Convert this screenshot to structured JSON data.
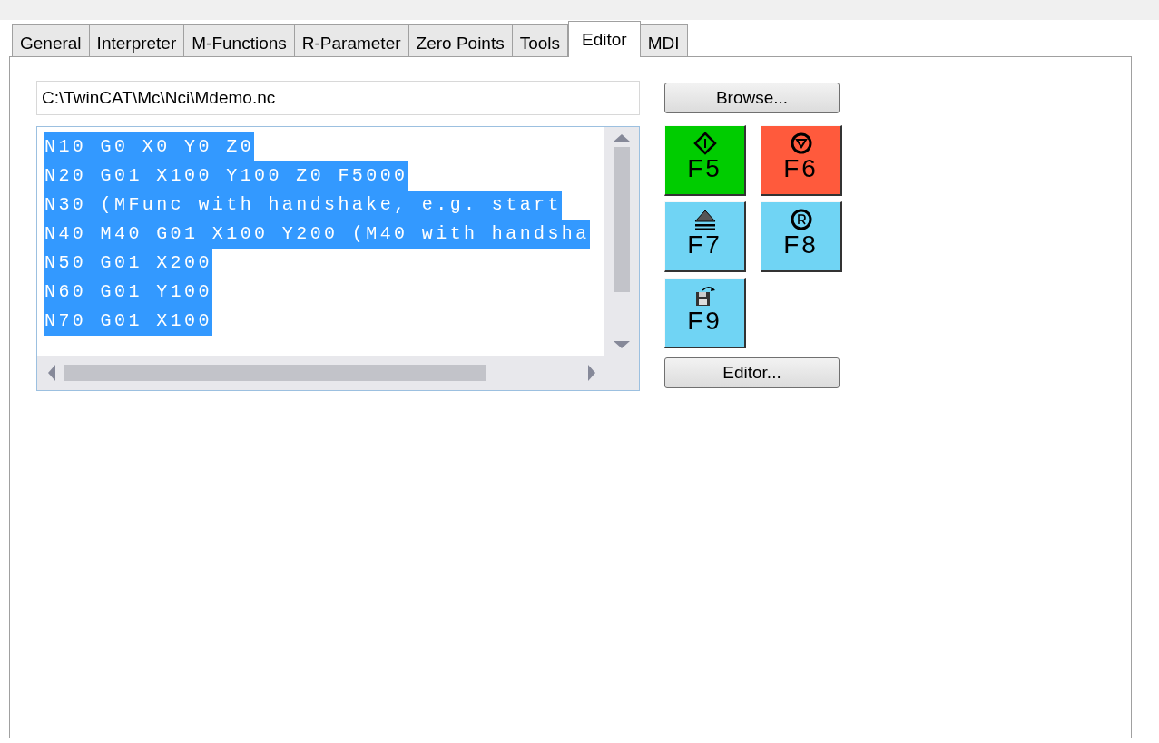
{
  "tabs": [
    {
      "label": "General",
      "selected": false
    },
    {
      "label": "Interpreter",
      "selected": false
    },
    {
      "label": "M-Functions",
      "selected": false
    },
    {
      "label": "R-Parameter",
      "selected": false
    },
    {
      "label": "Zero Points",
      "selected": false
    },
    {
      "label": "Tools",
      "selected": false
    },
    {
      "label": "Editor",
      "selected": true
    },
    {
      "label": "MDI",
      "selected": false
    }
  ],
  "file_path": "C:\\TwinCAT\\Mc\\Nci\\Mdemo.nc",
  "browse_button": "Browse...",
  "program_lines": [
    {
      "text": "N10 G0 X0 Y0 Z0",
      "selected": true
    },
    {
      "text": "N20 G01 X100 Y100 Z0 F5000",
      "selected": true
    },
    {
      "text": "N30 (MFunc with handshake, e.g. start",
      "selected": true
    },
    {
      "text": "N40 M40 G01 X100 Y200 (M40 with handsha",
      "selected": true
    },
    {
      "text": "N50 G01 X200",
      "selected": true
    },
    {
      "text": "N60 G01 Y100",
      "selected": true
    },
    {
      "text": "N70 G01 X100",
      "selected": true
    }
  ],
  "function_keys": [
    {
      "label": "F5",
      "kind": "start",
      "color": "#00cc00"
    },
    {
      "label": "F6",
      "kind": "stop",
      "color": "#ff5a3c"
    },
    {
      "label": "F7",
      "kind": "eject",
      "color": "#70d4f4"
    },
    {
      "label": "F8",
      "kind": "reset",
      "color": "#70d4f4"
    },
    {
      "label": "F9",
      "kind": "save",
      "color": "#70d4f4"
    }
  ],
  "editor_button": "Editor..."
}
